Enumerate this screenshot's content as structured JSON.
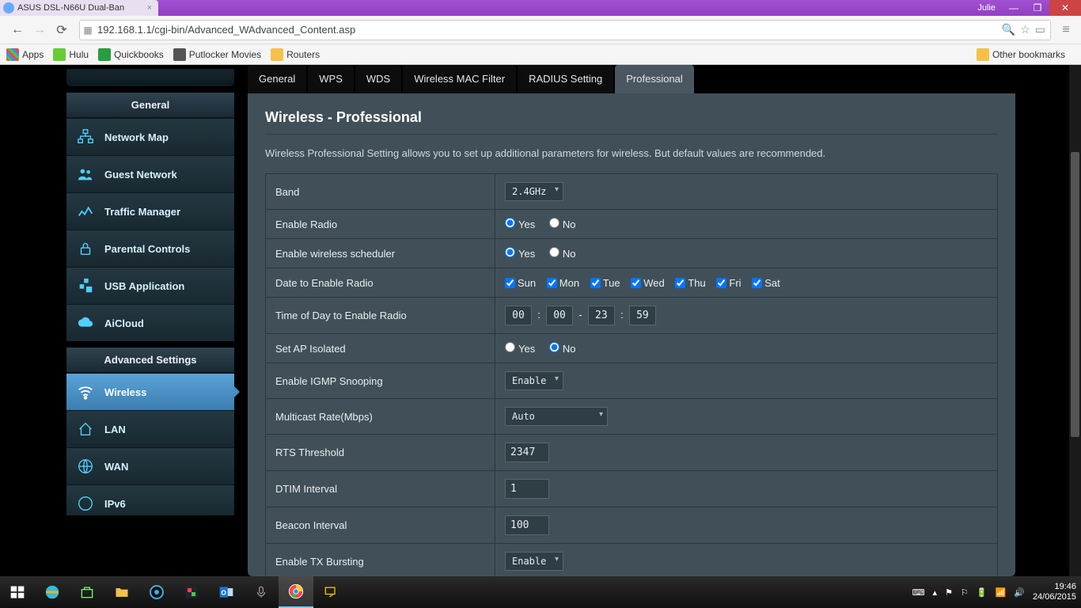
{
  "window": {
    "title": "ASUS DSL-N66U Dual-Ban",
    "user": "Julie"
  },
  "browser": {
    "url": "192.168.1.1/cgi-bin/Advanced_WAdvanced_Content.asp",
    "bookmarks": {
      "apps": "Apps",
      "hulu": "Hulu",
      "quickbooks": "Quickbooks",
      "putlocker": "Putlocker Movies",
      "routers": "Routers",
      "other": "Other bookmarks"
    }
  },
  "sidebar": {
    "general_head": "General",
    "general_items": [
      "Network Map",
      "Guest Network",
      "Traffic Manager",
      "Parental Controls",
      "USB Application",
      "AiCloud"
    ],
    "advanced_head": "Advanced Settings",
    "advanced_items": [
      "Wireless",
      "LAN",
      "WAN",
      "IPv6"
    ]
  },
  "tabs": [
    "General",
    "WPS",
    "WDS",
    "Wireless MAC Filter",
    "RADIUS Setting",
    "Professional"
  ],
  "panel": {
    "title": "Wireless - Professional",
    "desc": "Wireless Professional Setting allows you to set up additional parameters for wireless. But default values are recommended.",
    "rows": {
      "band": "Band",
      "band_val": "2.4GHz",
      "enable_radio": "Enable Radio",
      "enable_sched": "Enable wireless scheduler",
      "date_enable": "Date to Enable Radio",
      "days": [
        "Sun",
        "Mon",
        "Tue",
        "Wed",
        "Thu",
        "Fri",
        "Sat"
      ],
      "time_enable": "Time of Day to Enable Radio",
      "time": {
        "h1": "00",
        "m1": "00",
        "h2": "23",
        "m2": "59"
      },
      "ap_isolated": "Set AP Isolated",
      "igmp": "Enable IGMP Snooping",
      "igmp_val": "Enable",
      "mcast": "Multicast Rate(Mbps)",
      "mcast_val": "Auto",
      "rts": "RTS Threshold",
      "rts_val": "2347",
      "dtim": "DTIM Interval",
      "dtim_val": "1",
      "beacon": "Beacon Interval",
      "beacon_val": "100",
      "txburst": "Enable TX Bursting",
      "txburst_val": "Enable",
      "yes": "Yes",
      "no": "No"
    }
  },
  "taskbar": {
    "time": "19:46",
    "date": "24/06/2015"
  }
}
